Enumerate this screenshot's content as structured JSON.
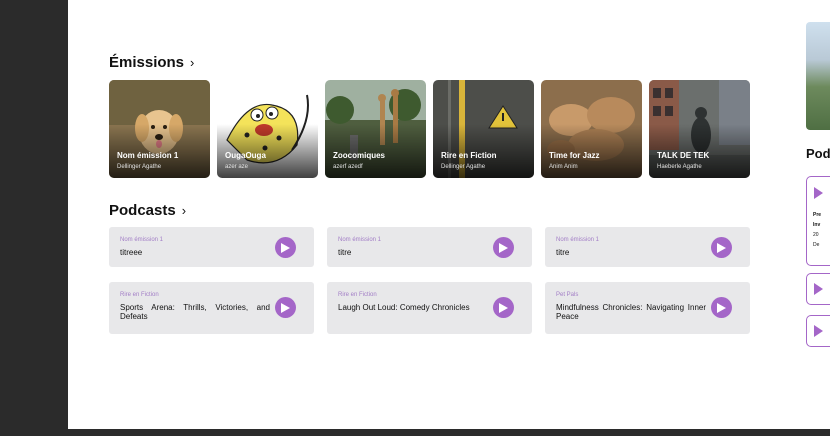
{
  "sections": {
    "emissions_title": "Émissions",
    "podcasts_title": "Podcasts",
    "chevron": "›"
  },
  "emissions": [
    {
      "title": "Nom émission 1",
      "author": "Dellinger Agathe",
      "image": "puppy-photo",
      "bg": "#7a6a4a"
    },
    {
      "title": "OugaOuga",
      "author": "azer aze",
      "image": "marsupilami-cartoon",
      "bg": "#f2e46a"
    },
    {
      "title": "Zoocomiques",
      "author": "azerf azedf",
      "image": "zoo-giraffes-photo",
      "bg": "#5c6b4c"
    },
    {
      "title": "Rire en Fiction",
      "author": "Dellinger Agathe",
      "image": "warning-sign-photo",
      "bg": "#4b4b48"
    },
    {
      "title": "Time for Jazz",
      "author": "Anim Anim",
      "image": "camels-photo",
      "bg": "#9b7a55"
    },
    {
      "title": "TALK DE TEK",
      "author": "Haeberle Agathe",
      "image": "street-statue-photo",
      "bg": "#5a5e60"
    }
  ],
  "podcasts": [
    {
      "category": "Nom émission 1",
      "title": "titreee"
    },
    {
      "category": "Nom émission 1",
      "title": "titre"
    },
    {
      "category": "Nom émission 1",
      "title": "titre"
    },
    {
      "category": "Rire en Fiction",
      "title": "Sports Arena: Thrills, Victories, and Defeats"
    },
    {
      "category": "Rire en Fiction",
      "title": "Laugh Out Loud: Comedy Chronicles"
    },
    {
      "category": "Pet Pals",
      "title": "Mindfulness Chronicles: Navigating Inner Peace"
    }
  ],
  "right_panel": {
    "title": "Podcasts",
    "card_lines": [
      "Pre",
      "Inv",
      "20",
      "De"
    ]
  },
  "colors": {
    "accent": "#a466c8",
    "category_text": "#a27ec6",
    "pod_bg": "#e8e8ea"
  },
  "icons": {
    "play": "play-icon",
    "chevron": "chevron-right-icon"
  }
}
